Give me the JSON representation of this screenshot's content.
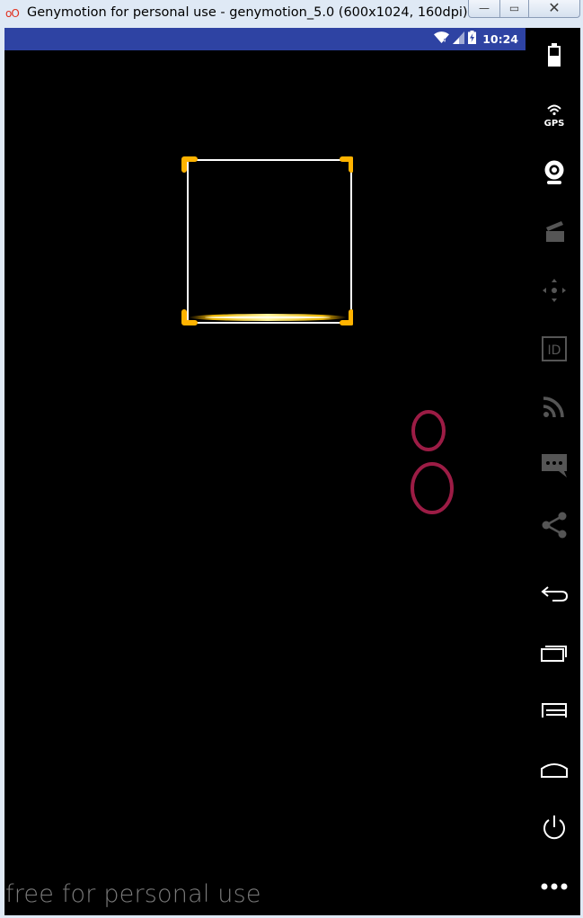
{
  "window": {
    "logo": "oO",
    "title": "Genymotion for personal use - genymotion_5.0 (600x1024, 160dpi)...",
    "buttons": {
      "minimize": "—",
      "maximize": "▭",
      "close": "✕"
    }
  },
  "statusbar": {
    "time": "10:24",
    "icons": [
      "wifi-icon",
      "signal-icon",
      "battery-charging-icon"
    ]
  },
  "screen": {
    "watermark": "free for personal use",
    "focus_frame_color": "#ffb300",
    "ring_color": "#9c1c45"
  },
  "toolbar": {
    "items": [
      {
        "name": "battery-icon",
        "enabled": true
      },
      {
        "name": "gps-icon",
        "label": "GPS",
        "enabled": true
      },
      {
        "name": "webcam-icon",
        "enabled": true
      },
      {
        "name": "media-icon",
        "enabled": false
      },
      {
        "name": "dpad-icon",
        "enabled": false
      },
      {
        "name": "id-icon",
        "label": "ID",
        "enabled": false
      },
      {
        "name": "rss-icon",
        "enabled": false
      },
      {
        "name": "sms-icon",
        "enabled": false
      },
      {
        "name": "share-icon",
        "enabled": false
      },
      {
        "name": "back-icon",
        "enabled": true
      },
      {
        "name": "recent-apps-icon",
        "enabled": true
      },
      {
        "name": "menu-icon",
        "enabled": true
      },
      {
        "name": "home-icon",
        "enabled": true
      },
      {
        "name": "power-icon",
        "enabled": true
      },
      {
        "name": "more-icon",
        "enabled": true
      }
    ]
  }
}
